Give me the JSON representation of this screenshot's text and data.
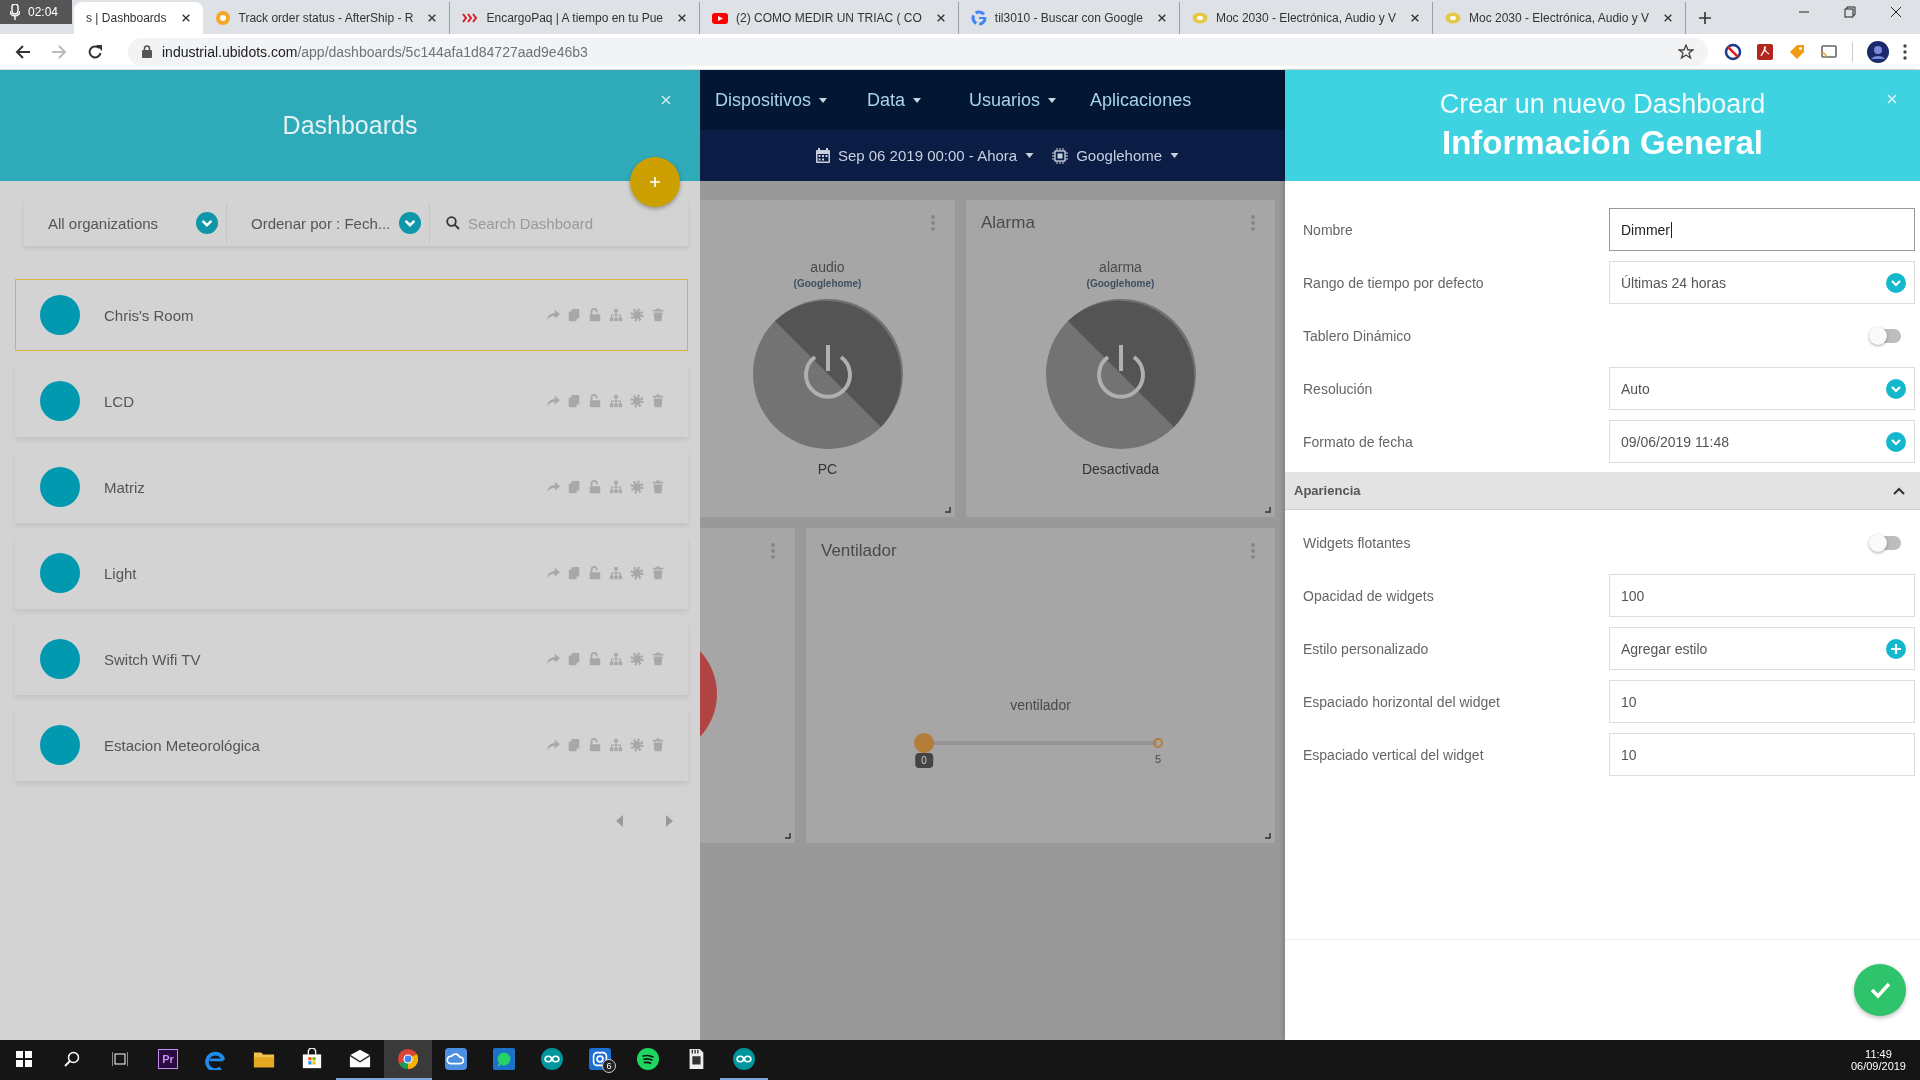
{
  "browser": {
    "recording_time": "02:04",
    "tabs": [
      {
        "title": "s | Dashboards",
        "kind": "page",
        "selected": true
      },
      {
        "title": "Track order status - AfterShip - R",
        "kind": "tracking",
        "selected": false
      },
      {
        "title": "EncargoPaq | A tiempo en tu Pue",
        "kind": "parcel",
        "selected": false
      },
      {
        "title": "(2) COMO MEDIR UN TRIAC ( CO",
        "kind": "video",
        "selected": false
      },
      {
        "title": "til3010 - Buscar con Google",
        "kind": "search",
        "selected": false
      },
      {
        "title": "Moc 2030 - Electrónica, Audio y V",
        "kind": "shop",
        "selected": false
      },
      {
        "title": "Moc 2030 - Electrónica, Audio y V",
        "kind": "shop",
        "selected": false
      }
    ],
    "url_host": "industrial.ubidots.com",
    "url_path": "/app/dashboards/5c144afa1d84727aad9e46b3"
  },
  "dashboards_panel": {
    "title": "Dashboards",
    "organization": "All organizations",
    "order": "Ordenar por : Fech...",
    "search_placeholder": "Search Dashboard",
    "items": [
      {
        "name": "Chris's Room",
        "selected": true
      },
      {
        "name": "LCD",
        "selected": false
      },
      {
        "name": "Matriz",
        "selected": false
      },
      {
        "name": "Light",
        "selected": false
      },
      {
        "name": "Switch Wifi TV",
        "selected": false
      },
      {
        "name": "Estacion Meteorológica",
        "selected": false
      }
    ]
  },
  "navbar": {
    "items": [
      {
        "label": "Dispositivos",
        "dropdown": true
      },
      {
        "label": "Data",
        "dropdown": true
      },
      {
        "label": "Usuarios",
        "dropdown": true
      },
      {
        "label": "Aplicaciones",
        "dropdown": false
      }
    ],
    "date_range": "Sep 06 2019 00:00 - Ahora",
    "device": "Googlehome"
  },
  "widgets": [
    {
      "kind": "switch",
      "variable": "audio",
      "device": "(Googlehome)",
      "state_label": "PC",
      "on": false
    },
    {
      "kind": "switch",
      "title": "Alarma",
      "variable": "alarma",
      "device": "(Googlehome)",
      "state_label": "Desactivada",
      "on": false
    },
    {
      "kind": "indicator"
    },
    {
      "kind": "slider",
      "title": "Ventilador",
      "variable": "ventilador",
      "level": 0,
      "value": "0",
      "max": "5"
    }
  ],
  "new_dashboard": {
    "title": "Crear un nuevo Dashboard",
    "subtitle": "Información General",
    "fields": [
      {
        "kind": "input",
        "label": "Nombre",
        "value": "Dimmer",
        "focused": true
      },
      {
        "kind": "select",
        "label": "Rango de tiempo por defecto",
        "value": "Últimas 24 horas"
      },
      {
        "kind": "toggle",
        "label": "Tablero Dinámico",
        "on": false
      },
      {
        "kind": "select",
        "label": "Resolución",
        "value": "Auto"
      },
      {
        "kind": "select",
        "label": "Formato de fecha",
        "value": "09/06/2019 11:48"
      }
    ],
    "section": {
      "title": "Apariencia",
      "expanded": true
    },
    "appearance_fields": [
      {
        "kind": "toggle",
        "label": "Widgets flotantes",
        "on": false
      },
      {
        "kind": "input",
        "label": "Opacidad de widgets",
        "value": "100",
        "focused": false
      },
      {
        "kind": "add",
        "label": "Estilo personalizado",
        "value": "Agregar estilo"
      },
      {
        "kind": "input",
        "label": "Espaciado horizontal del widget",
        "value": "10",
        "focused": false
      },
      {
        "kind": "input",
        "label": "Espaciado vertical del widget",
        "value": "10",
        "focused": false
      }
    ]
  },
  "taskbar": {
    "apps": [
      {
        "kind": "premiere",
        "text": "Pr",
        "running": false,
        "selected": false
      },
      {
        "kind": "edge",
        "running": false,
        "selected": false
      },
      {
        "kind": "explorer",
        "running": false,
        "selected": false
      },
      {
        "kind": "store",
        "running": false,
        "selected": false
      },
      {
        "kind": "mail",
        "running": true,
        "selected": false
      },
      {
        "kind": "chrome",
        "running": true,
        "selected": true
      },
      {
        "kind": "cloud",
        "running": false,
        "selected": false
      },
      {
        "kind": "whatsapp",
        "running": false,
        "selected": false
      },
      {
        "kind": "arduino",
        "running": false,
        "selected": false
      },
      {
        "kind": "camera",
        "badge": "6",
        "running": false,
        "selected": false
      },
      {
        "kind": "spotify",
        "running": false,
        "selected": false
      },
      {
        "kind": "sdcard",
        "running": false,
        "selected": false
      },
      {
        "kind": "arduino",
        "running": true,
        "selected": false
      }
    ],
    "time": "11:49",
    "date": "06/09/2019"
  }
}
